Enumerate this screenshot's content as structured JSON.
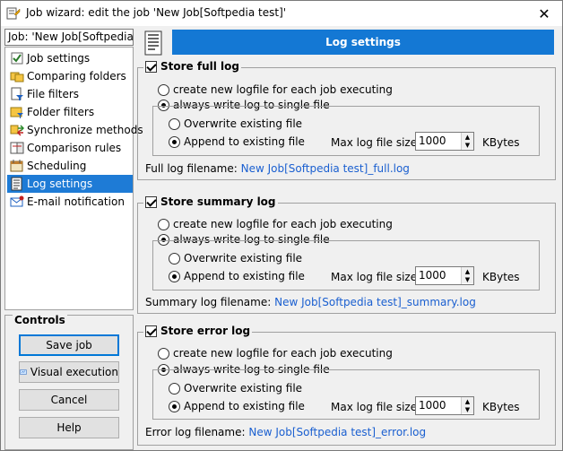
{
  "window": {
    "title": "Job wizard: edit the job 'New Job[Softpedia test]'",
    "close_glyph": "✕"
  },
  "job_field": {
    "value": "Job: 'New Job[Softpedia test]'"
  },
  "nav": {
    "items": [
      {
        "label": "Job settings"
      },
      {
        "label": "Comparing folders"
      },
      {
        "label": "File filters"
      },
      {
        "label": "Folder filters"
      },
      {
        "label": "Synchronize methods"
      },
      {
        "label": "Comparison rules"
      },
      {
        "label": "Scheduling"
      },
      {
        "label": "Log settings"
      },
      {
        "label": "E-mail notification"
      }
    ],
    "selected_index": 7
  },
  "controls": {
    "title": "Controls",
    "save": "Save job",
    "visual": "Visual execution",
    "cancel": "Cancel",
    "help": "Help"
  },
  "header": {
    "title": "Log settings"
  },
  "sections": {
    "full": {
      "title": "Store full log",
      "opt_new": "create new logfile for each job executing",
      "opt_single": "always write log to single file",
      "opt_overwrite": "Overwrite existing file",
      "opt_append": "Append to existing file",
      "max_label": "Max log file size:",
      "max_value": "1000",
      "unit": "KBytes",
      "fname_label": "Full log filename:",
      "fname_value": "New Job[Softpedia test]_full.log"
    },
    "summary": {
      "title": "Store summary log",
      "opt_new": "create new logfile for each job executing",
      "opt_single": "always write log to single file",
      "opt_overwrite": "Overwrite existing file",
      "opt_append": "Append to existing file",
      "max_label": "Max log file size:",
      "max_value": "1000",
      "unit": "KBytes",
      "fname_label": "Summary log filename:",
      "fname_value": "New Job[Softpedia test]_summary.log"
    },
    "error": {
      "title": "Store error log",
      "opt_new": "create new logfile for each job executing",
      "opt_single": "always write log to single file",
      "opt_overwrite": "Overwrite existing file",
      "opt_append": "Append to existing file",
      "max_label": "Max log file size:",
      "max_value": "1000",
      "unit": "KBytes",
      "fname_label": "Error log filename:",
      "fname_value": "New Job[Softpedia test]_error.log"
    }
  },
  "colors": {
    "accent": "#1478d4",
    "selected": "#1e7bd6",
    "link": "#1a5fd0"
  }
}
